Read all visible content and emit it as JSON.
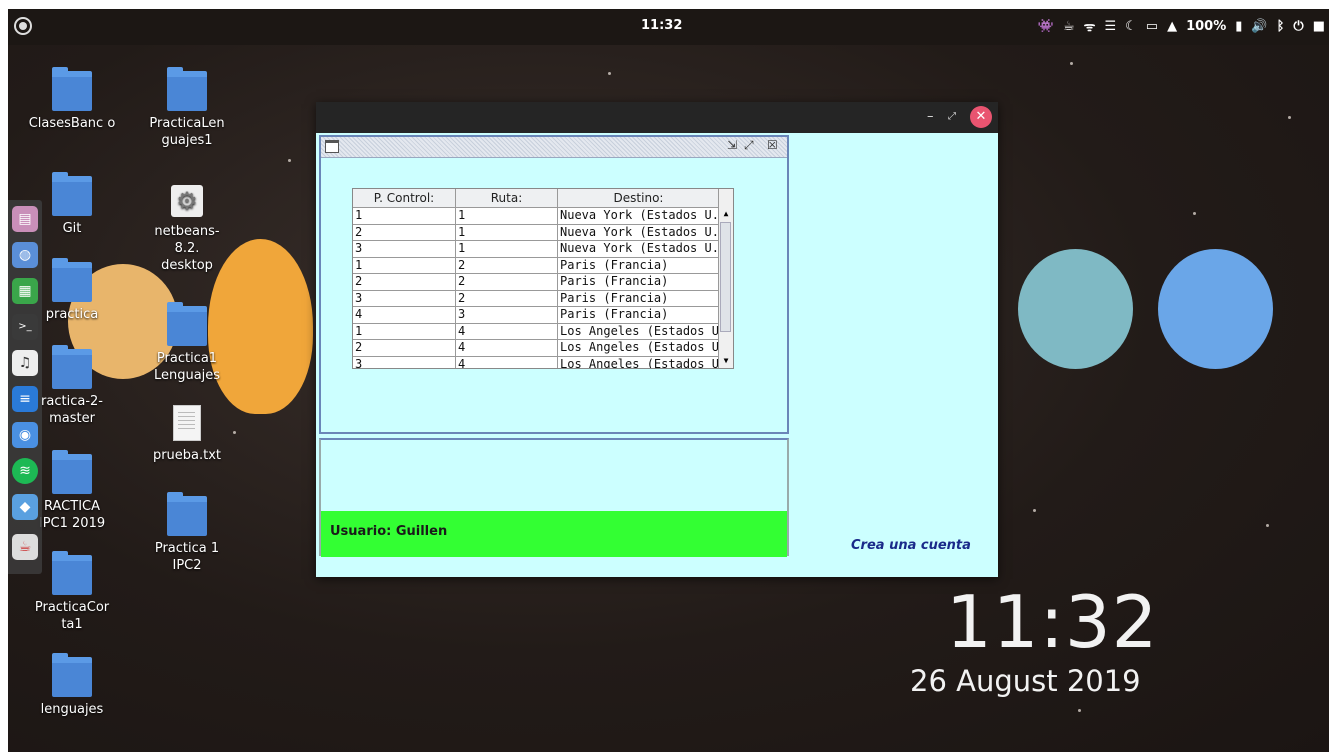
{
  "topbar": {
    "clock": "11:32",
    "battery": "100%"
  },
  "desktop_icons": [
    {
      "label": "ClasesBanc o",
      "type": "folder"
    },
    {
      "label": "PracticaLen guajes1",
      "type": "folder"
    },
    {
      "label": "Git",
      "type": "folder"
    },
    {
      "label": "netbeans-8.2. desktop",
      "type": "launcher"
    },
    {
      "label": "practica",
      "type": "folder"
    },
    {
      "label": "Practica1 Lenguajes",
      "type": "folder"
    },
    {
      "label": "ractica-2-master",
      "type": "folder"
    },
    {
      "label": "prueba.txt",
      "type": "text"
    },
    {
      "label": "RACTICA IPC1 2019",
      "type": "folder"
    },
    {
      "label": "Practica 1 IPC2",
      "type": "folder"
    },
    {
      "label": "PracticaCor ta1",
      "type": "folder"
    },
    {
      "label": "lenguajes",
      "type": "folder"
    }
  ],
  "dock": [
    "files-icon",
    "browser-icon",
    "spreadsheet-icon",
    "terminal-icon",
    "music-icon",
    "text-editor-icon",
    "chrome-icon",
    "spotify-icon",
    "virtualbox-icon",
    "java-icon"
  ],
  "window": {
    "table": {
      "headers": [
        "P. Control:",
        "Ruta:",
        "Destino:"
      ],
      "rows": [
        [
          "1",
          "1",
          "Nueva York (Estados U..."
        ],
        [
          "2",
          "1",
          "Nueva York (Estados U..."
        ],
        [
          "3",
          "1",
          "Nueva York (Estados U..."
        ],
        [
          "1",
          "2",
          "Paris (Francia)"
        ],
        [
          "2",
          "2",
          "Paris (Francia)"
        ],
        [
          "3",
          "2",
          "Paris (Francia)"
        ],
        [
          "4",
          "3",
          "Paris (Francia)"
        ],
        [
          "1",
          "4",
          "Los Angeles (Estados U..."
        ],
        [
          "2",
          "4",
          "Los Angeles (Estados U..."
        ],
        [
          "3",
          "4",
          "Los Angeles (Estados U..."
        ]
      ]
    },
    "user_label": "Usuario: Guillen",
    "create_account": "Crea una cuenta"
  },
  "desktop_clock": {
    "time": "11:32",
    "date": "26 August 2019"
  },
  "colors": {
    "window_bg": "#ccffff",
    "user_bar": "#33ff33",
    "close_button": "#e95470",
    "link": "#1a2a8a"
  }
}
